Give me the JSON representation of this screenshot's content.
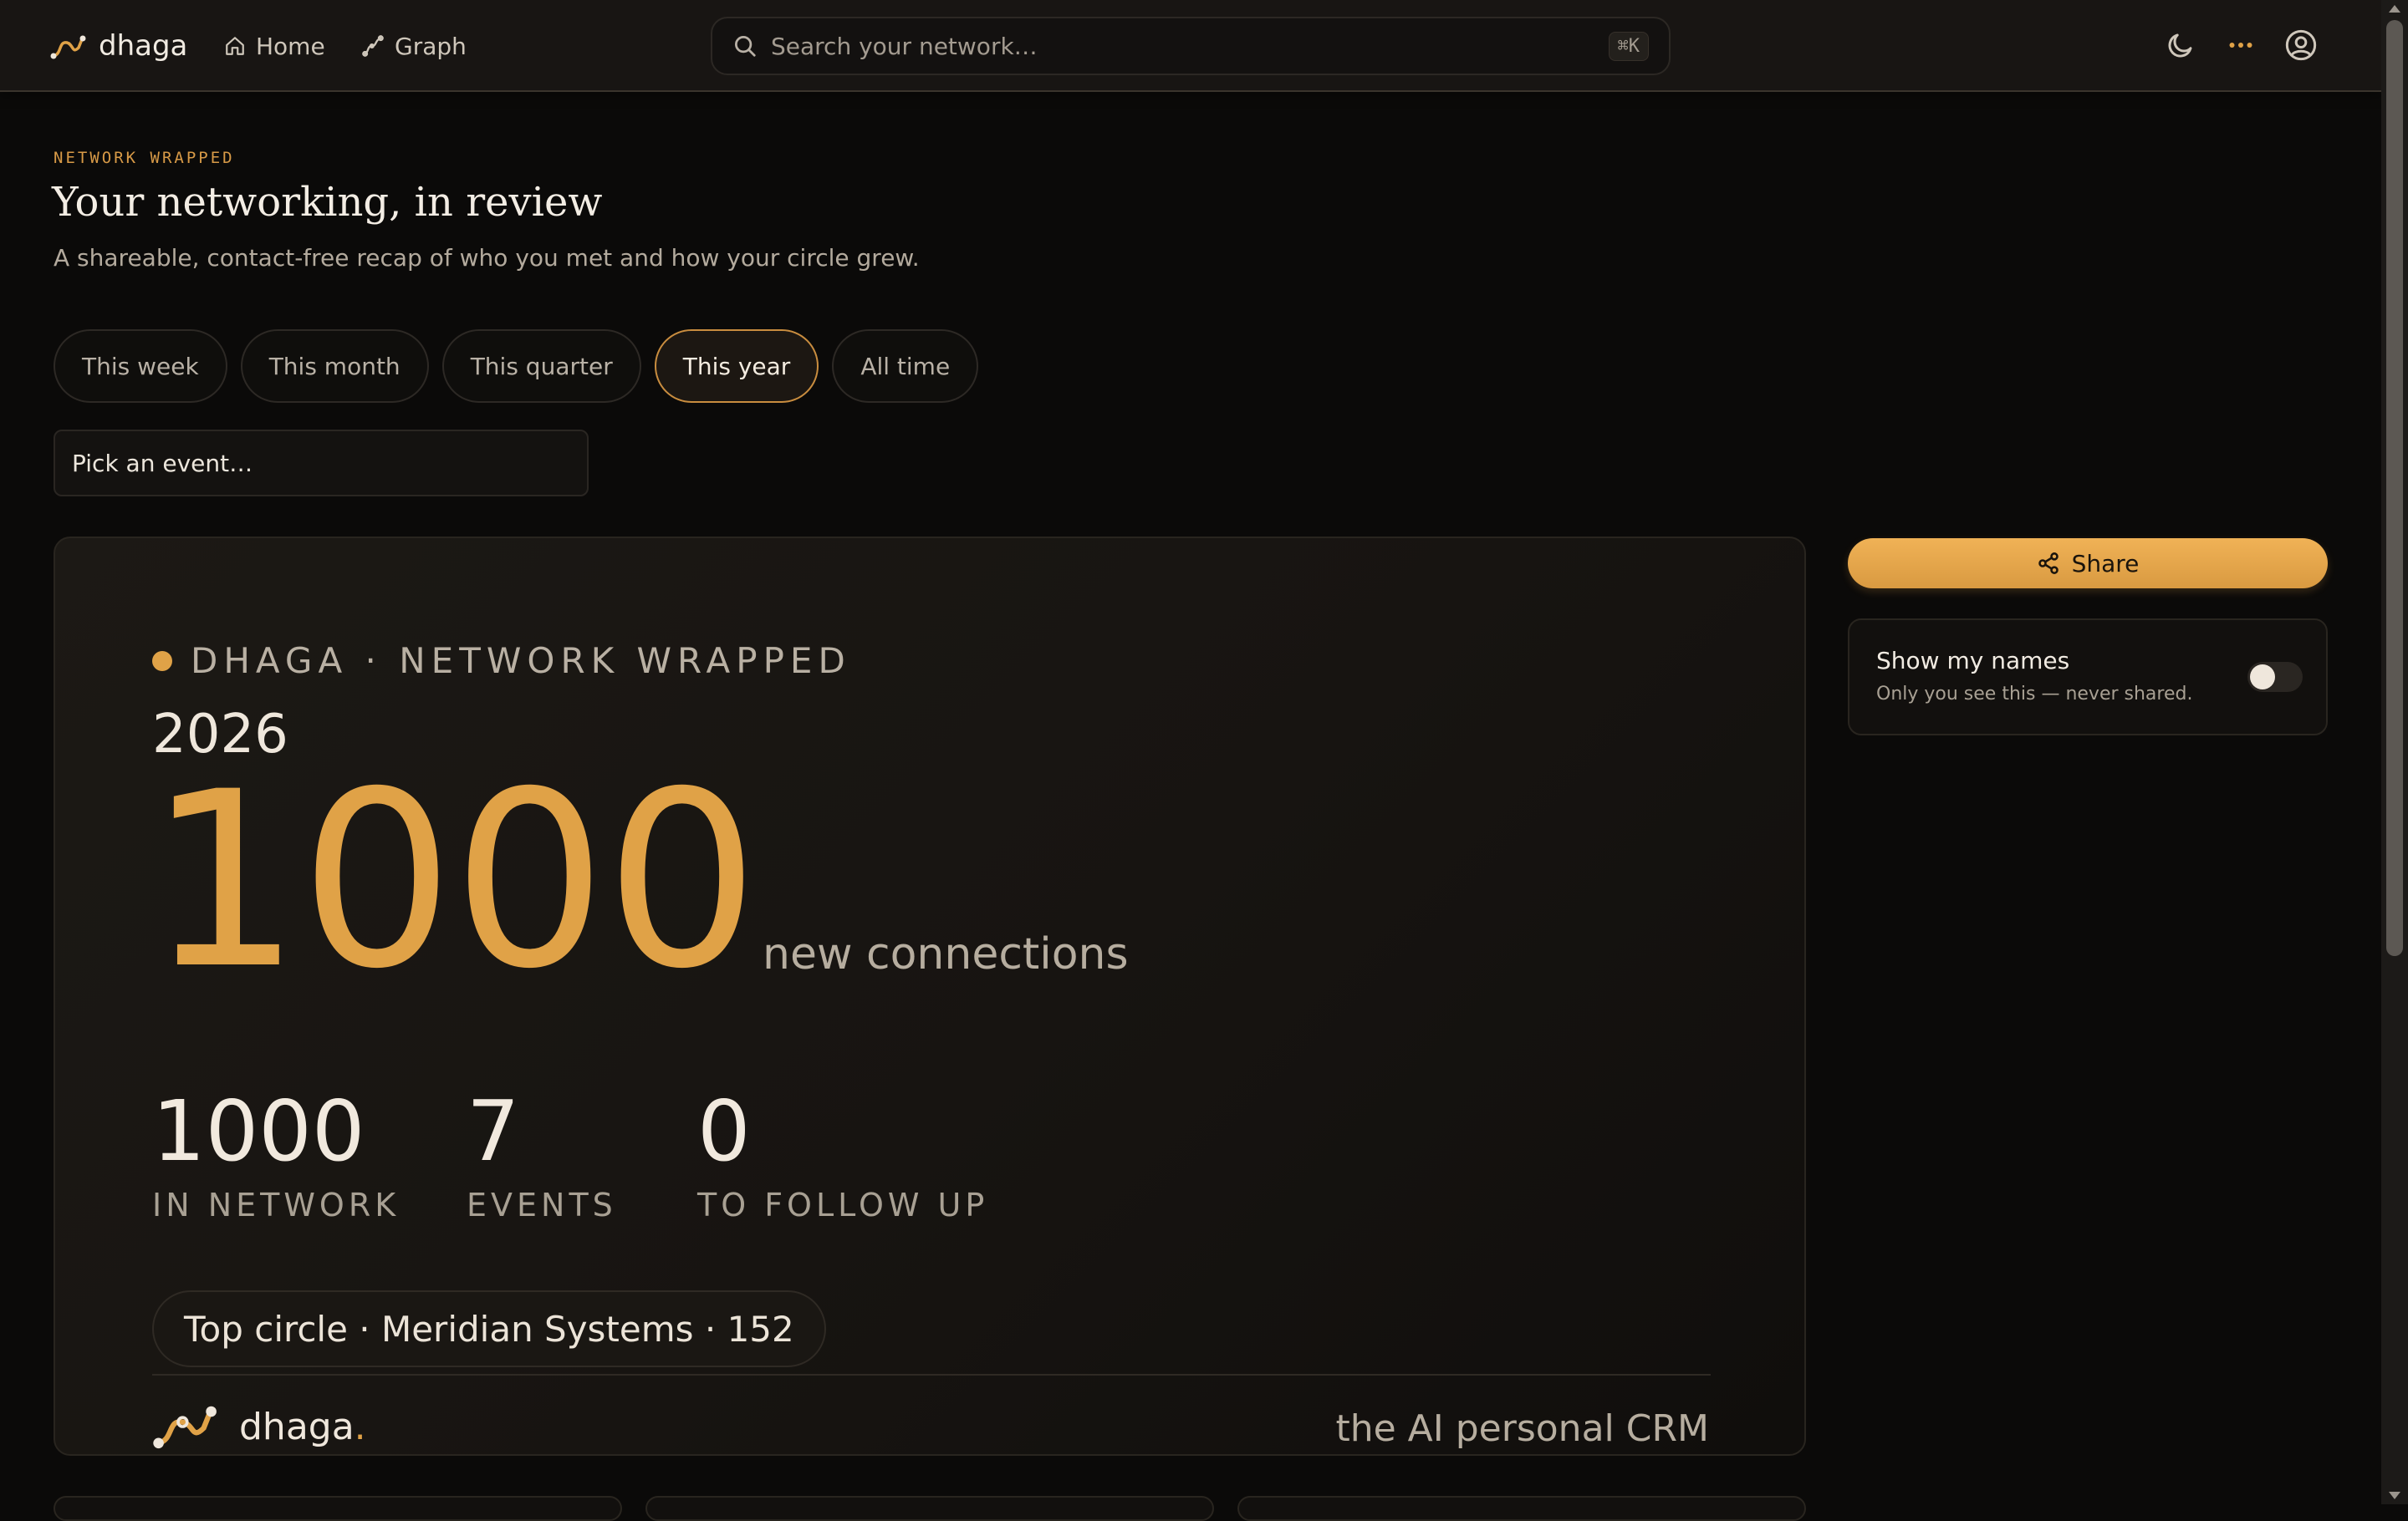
{
  "nav": {
    "brand": "dhaga",
    "links": [
      {
        "label": "Home",
        "icon": "home-icon"
      },
      {
        "label": "Graph",
        "icon": "graph-icon"
      }
    ],
    "search": {
      "placeholder": "Search your network…",
      "shortcut": "⌘K"
    },
    "icons": [
      "moon-icon",
      "more-icon",
      "user-icon"
    ]
  },
  "header": {
    "eyebrow": "NETWORK WRAPPED",
    "title": "Your networking, in review",
    "subtitle": "A shareable, contact-free recap of who you met and how your circle grew."
  },
  "periods": {
    "options": [
      "This week",
      "This month",
      "This quarter",
      "This year",
      "All time"
    ],
    "selected": "This year"
  },
  "event_picker": {
    "placeholder": "Pick an event…"
  },
  "card": {
    "kicker": "DHAGA · NETWORK WRAPPED",
    "year": "2026",
    "big_number": "1000",
    "big_label": "new connections",
    "stats": [
      {
        "value": "1000",
        "label": "IN NETWORK"
      },
      {
        "value": "7",
        "label": "EVENTS"
      },
      {
        "value": "0",
        "label": "TO FOLLOW UP"
      }
    ],
    "top_circle": "Top circle · Meridian Systems · 152",
    "footer_brand": "dhaga",
    "footer_brand_period": ".",
    "tagline": "the AI personal CRM"
  },
  "share": {
    "label": "Share"
  },
  "names_toggle": {
    "title": "Show my names",
    "subtitle": "Only you see this — never shared.",
    "enabled": false
  },
  "colors": {
    "accent": "#e0a247",
    "background": "#0b0a09"
  }
}
